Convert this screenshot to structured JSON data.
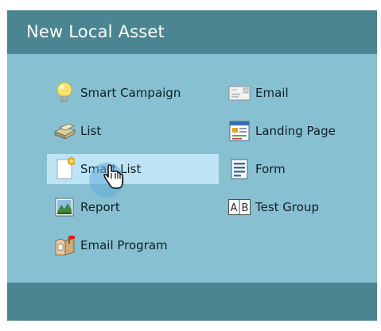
{
  "dialog": {
    "title": "New Local Asset"
  },
  "left_items": [
    {
      "label": "Smart Campaign",
      "icon": "lightbulb-icon"
    },
    {
      "label": "List",
      "icon": "list-icon"
    },
    {
      "label": "Smart List",
      "icon": "smart-list-icon"
    },
    {
      "label": "Report",
      "icon": "report-icon"
    },
    {
      "label": "Email Program",
      "icon": "email-program-icon"
    }
  ],
  "right_items": [
    {
      "label": "Email",
      "icon": "email-icon"
    },
    {
      "label": "Landing Page",
      "icon": "landing-page-icon"
    },
    {
      "label": "Form",
      "icon": "form-icon"
    },
    {
      "label": "Test Group",
      "icon": "test-group-icon"
    }
  ],
  "colors": {
    "header": "#4b8592",
    "body": "#87c0d0",
    "highlight": "#bde4f4"
  }
}
